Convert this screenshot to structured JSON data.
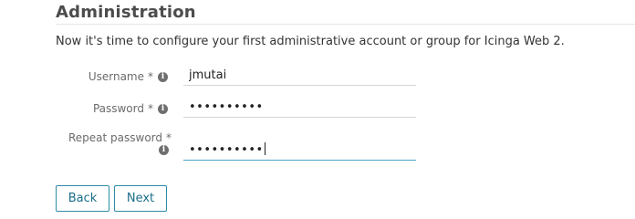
{
  "page": {
    "title": "Administration",
    "intro": "Now it's time to configure your first administrative account or group for Icinga Web 2."
  },
  "form": {
    "username": {
      "label": "Username",
      "required_marker": "*",
      "value": "jmutai"
    },
    "password": {
      "label": "Password",
      "required_marker": "*",
      "masked_value": "••••••••••"
    },
    "repeat_password": {
      "label": "Repeat password",
      "required_marker": "*",
      "masked_value": "••••••••••"
    },
    "info_icon_glyph": "i"
  },
  "buttons": {
    "back": "Back",
    "next": "Next"
  },
  "colors": {
    "accent": "#2f8ba8",
    "active_underline": "#4aa3c4"
  }
}
